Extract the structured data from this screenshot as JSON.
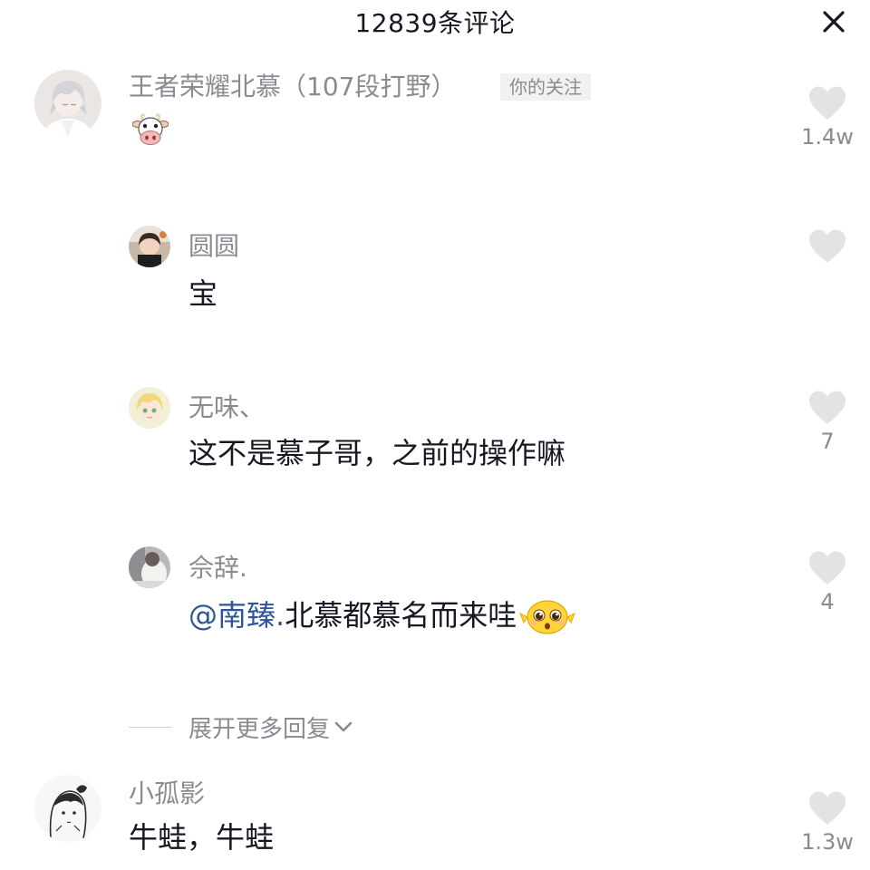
{
  "header": {
    "title": "12839条评论",
    "close_icon": "close-icon"
  },
  "comments": [
    {
      "username": "王者荣耀北慕（107段打野）",
      "tag": "你的关注",
      "body_emoji": "cow-face-emoji",
      "likes": "1.4w",
      "avatar_icon": "anime-avatar-silver-hair"
    }
  ],
  "replies": [
    {
      "username": "圆圆",
      "text": "宝",
      "likes": "",
      "avatar_icon": "avatar-photo"
    },
    {
      "username": "无味、",
      "text": "这不是慕子哥，之前的操作嘛",
      "likes": "7",
      "avatar_icon": "anime-avatar-blonde"
    },
    {
      "username": "佘辞.",
      "mention": "@南臻.",
      "text": " 北慕都慕名而来哇",
      "trailing_emoji": "pleading-face-emoji",
      "likes": "4",
      "avatar_icon": "avatar-photo-grey"
    }
  ],
  "expand": {
    "label": "展开更多回复",
    "icon": "chevron-down-icon"
  },
  "comment2": {
    "username": "小孤影",
    "text": "牛蛙，牛蛙",
    "likes": "1.3w",
    "avatar_icon": "anime-avatar-sketch"
  },
  "colors": {
    "text_primary": "#161823",
    "text_secondary": "#8a8b91",
    "mention": "#2f5597",
    "heart": "#e3e3e6",
    "tag_bg": "#f1f1f2"
  }
}
